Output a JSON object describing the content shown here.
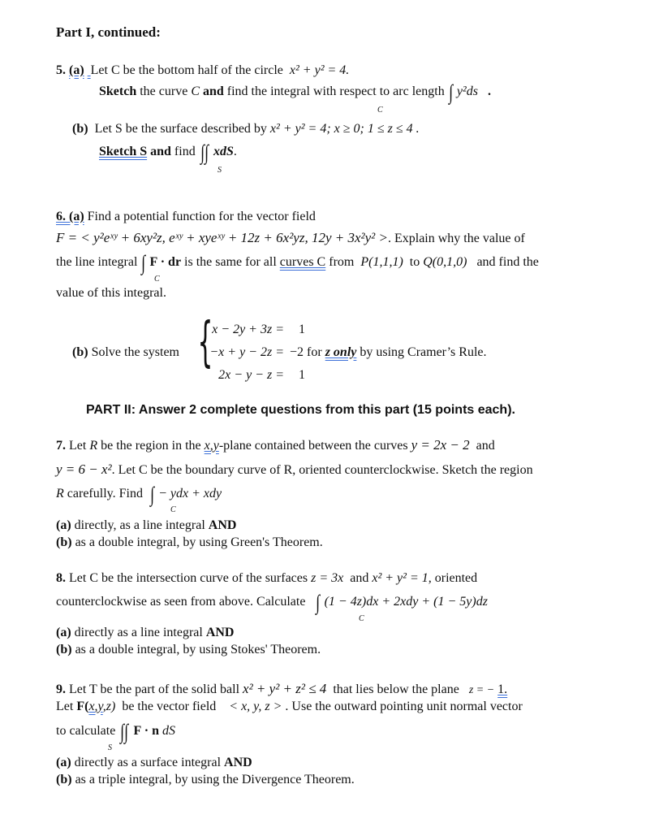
{
  "header": {
    "title": "Part I, continued:"
  },
  "q5": {
    "number": "5.",
    "a_label": "(a)",
    "a_text": "Let C be the bottom half of the circle",
    "a_eq": "x² + y² = 4.",
    "a_line2_bold1": "Sketch",
    "a_line2_text1": "the curve",
    "a_line2_c": "C",
    "a_line2_bold2": "and",
    "a_line2_text2": "find the integral with respect to arc length",
    "a_integrand": "y²ds",
    "a_integral_sub": "C",
    "b_label": "(b)",
    "b_text": "Let S be the surface described by",
    "b_eq": "x² + y² = 4;  x ≥ 0;  1 ≤ z ≤ 4 .",
    "b_line2_bold": "Sketch  S",
    "b_line2_and": "and",
    "b_line2_find": "find",
    "b_integrand": "xdS",
    "b_integral_sub": "S"
  },
  "q6": {
    "label": "6.  (a)",
    "line1": "Find a potential function for the vector field",
    "field": "F = < y²eˣʸ + 6xy²z,  eˣʸ + xyeˣʸ + 12z + 6x²yz,  12y + 3x²y² >",
    "line2_tail": ". Explain why the value of",
    "line3_a": "the line integral",
    "line3_integrand": "F · dr",
    "line3_b": "is the same for all",
    "line3_curves": "curves  C",
    "line3_c": "from",
    "point_p": "P(1,1,1)",
    "line3_to": "to",
    "point_q": "Q(0,1,0)",
    "line3_d": "and find the",
    "integral_sub": "C",
    "line4": "value of this integral.",
    "b_label": "(b)",
    "b_text": "Solve the system",
    "system": [
      "x − 2y + 3z =",
      "−x + y − 2z =",
      "2x − y − z ="
    ],
    "rhs": [
      "1",
      "−2",
      "1"
    ],
    "b_for": "for",
    "b_zonly": "z  only",
    "b_tail": "by using Cramer’s Rule."
  },
  "part2": {
    "heading": "PART II: Answer 2 complete questions from this part (15 points each)."
  },
  "q7": {
    "number": "7.",
    "line1_a": "Let",
    "line1_r": "R",
    "line1_b": "be the region in the",
    "line1_xy": "x,y",
    "line1_c": "-plane contained between the curves",
    "curve1": "y = 2x − 2",
    "line1_and": "and",
    "curve2": "y = 6 − x²",
    "line2": ". Let C be the boundary curve of R, oriented counterclockwise.  Sketch the region",
    "line3_r": "R",
    "line3": "carefully.  Find",
    "integrand": "− ydx + xdy",
    "integral_sub": "C",
    "a_label": "(a)",
    "a_text": "directly, as a line integral",
    "a_and": "AND",
    "b_label": "(b)",
    "b_text": "as a double integral, by using Green's Theorem."
  },
  "q8": {
    "number": "8.",
    "line1": "Let C be the intersection curve of the surfaces",
    "surf1": "z = 3x",
    "line1_and": "and",
    "surf2": "x² + y² = 1,",
    "line1_tail": "oriented",
    "line2": "counterclockwise as seen from above.    Calculate",
    "integrand": "(1 − 4z)dx + 2xdy + (1 − 5y)dz",
    "integral_sub": "C",
    "a_label": "(a)",
    "a_text": "directly as a line integral",
    "a_and": "AND",
    "b_label": "(b)",
    "b_text": "as a double integral, by using Stokes' Theorem."
  },
  "q9": {
    "number": "9.",
    "line1": "Let T be the part of the solid ball",
    "ball": "x² + y² + z² ≤ 4",
    "line1_mid": "that lies below the plane",
    "plane_lhs": "z = −",
    "plane_rhs": "1.",
    "line2_a": "Let",
    "line2_F": "F(",
    "line2_xy": "x,y",
    "line2_z": ",z)",
    "line2_b": "be the vector field",
    "field": "< x, y, z >",
    "line2_c": ".  Use the outward pointing unit normal vector",
    "line3": "to calculate",
    "integrand_F": "F · n",
    "integrand_dS": "dS",
    "integral_sub": "S",
    "a_label": "(a)",
    "a_text": "directly as a surface integral",
    "a_and": "AND",
    "b_label": "(b)",
    "b_text": "as a triple integral, by using the Divergence Theorem."
  }
}
